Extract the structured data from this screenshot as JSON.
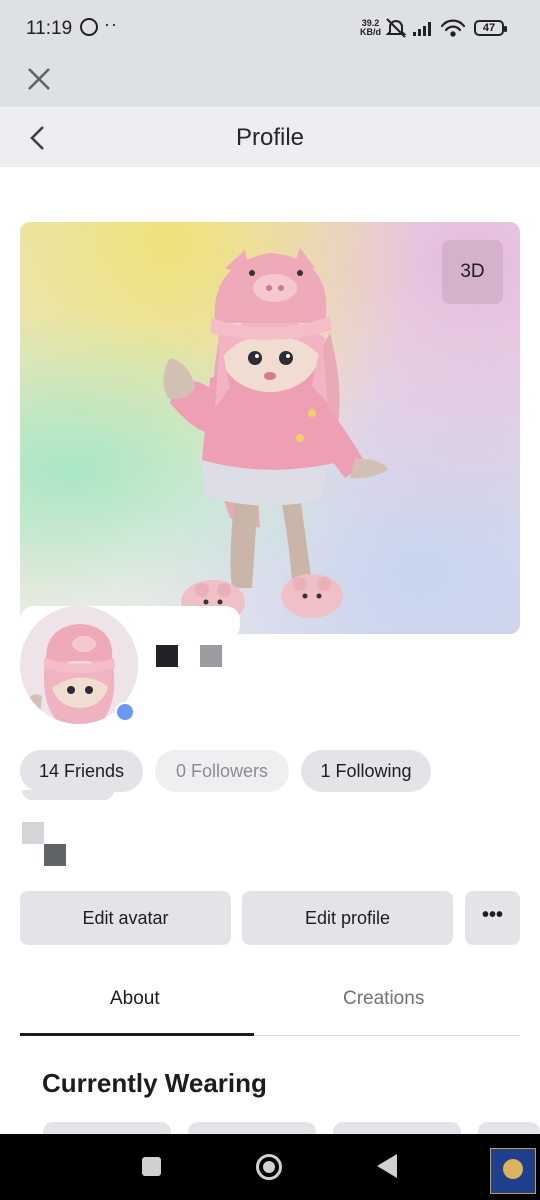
{
  "status_bar": {
    "time": "11:19",
    "dots": "··",
    "net_speed_value": "39.2",
    "net_speed_unit": "KB/d",
    "battery": "47"
  },
  "header": {
    "title": "Profile"
  },
  "hero": {
    "view_3d_label": "3D"
  },
  "stats": {
    "friends": "14 Friends",
    "followers": "0 Followers",
    "following": "1 Following"
  },
  "actions": {
    "edit_avatar": "Edit avatar",
    "edit_profile": "Edit profile",
    "more": "•••"
  },
  "tabs": [
    {
      "label": "About",
      "active": true
    },
    {
      "label": "Creations",
      "active": false
    }
  ],
  "section": {
    "currently_wearing": "Currently Wearing"
  },
  "colors": {
    "online_status": "#6a9af0",
    "chip_background": "#e3e4e7"
  },
  "icons": [
    "whatsapp-icon",
    "mute-icon",
    "signal-icon",
    "wifi-icon",
    "battery-icon",
    "close-icon",
    "back-icon",
    "more-icon",
    "nav-square-icon",
    "nav-home-icon",
    "nav-back-icon"
  ]
}
